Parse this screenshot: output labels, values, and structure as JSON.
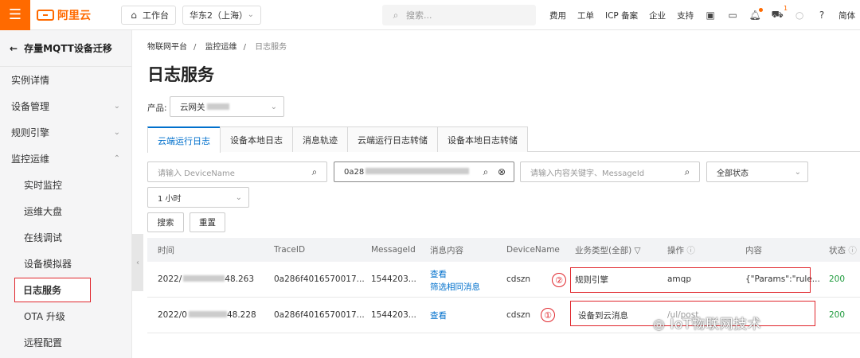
{
  "topbar": {
    "brand": "阿里云",
    "workbench": "工作台",
    "region": "华东2（上海）",
    "search_placeholder": "搜索...",
    "nav": [
      "费用",
      "工单",
      "ICP 备案",
      "企业",
      "支持"
    ],
    "cart_badge": "1",
    "lang": "简体"
  },
  "sidebar": {
    "back_title": "存量MQTT设备迁移",
    "items": [
      {
        "label": "实例详情"
      },
      {
        "label": "设备管理"
      },
      {
        "label": "规则引擎"
      },
      {
        "label": "监控运维"
      },
      {
        "label": "实时监控"
      },
      {
        "label": "运维大盘"
      },
      {
        "label": "在线调试"
      },
      {
        "label": "设备模拟器"
      },
      {
        "label": "日志服务"
      },
      {
        "label": "OTA 升级"
      },
      {
        "label": "远程配置"
      }
    ]
  },
  "breadcrumb": [
    "物联网平台",
    "监控运维",
    "日志服务"
  ],
  "page_title": "日志服务",
  "product": {
    "label": "产品:",
    "value": "云网关"
  },
  "tabs": [
    "云端运行日志",
    "设备本地日志",
    "消息轨迹",
    "云端运行日志转储",
    "设备本地日志转储"
  ],
  "filters": {
    "device_placeholder": "请输入 DeviceName",
    "trace_value": "0a28",
    "content_placeholder": "请输入内容关键字、MessageId",
    "status": "全部状态",
    "time": "1 小时",
    "search_btn": "搜索",
    "reset_btn": "重置"
  },
  "table": {
    "headers": [
      "时间",
      "TraceID",
      "MessageId",
      "消息内容",
      "DeviceName",
      "业务类型(全部)",
      "操作",
      "内容",
      "状态"
    ],
    "rows": [
      {
        "time": "2022/",
        "time_end": "48.263",
        "trace": "0a286f4016570017...",
        "msg": "1544203...",
        "view": "查看",
        "filter": "筛选相同消息",
        "device": "cdszn",
        "type": "规则引擎",
        "op": "amqp",
        "content": "{\"Params\":\"rule...",
        "status": "200"
      },
      {
        "time": "2022/0",
        "time_end": "48.228",
        "trace": "0a286f4016570017...",
        "msg": "1544203...",
        "view": "查看",
        "device": "cdszn",
        "type": "设备到云消息",
        "op": "/ul/post",
        "status": "200"
      }
    ]
  },
  "annotations": [
    "②",
    "①"
  ],
  "watermark": "IoT物联网技术"
}
